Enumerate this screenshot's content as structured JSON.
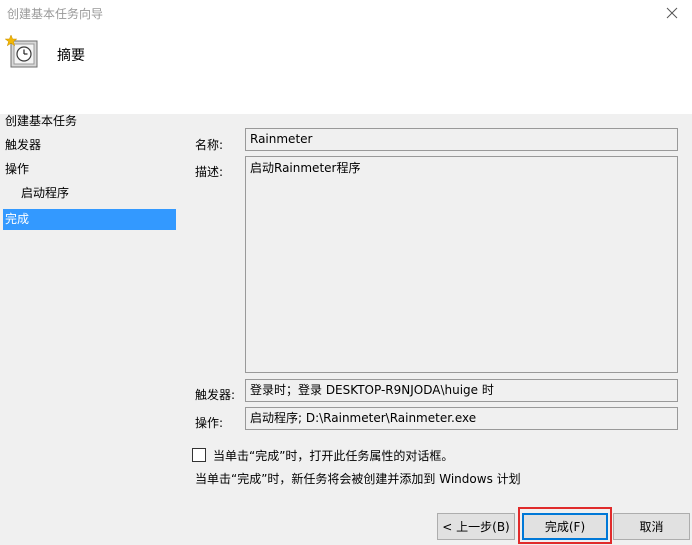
{
  "window": {
    "title": "创建基本任务向导"
  },
  "header": {
    "title": "摘要"
  },
  "nav": {
    "items": [
      {
        "label": "创建基本任务"
      },
      {
        "label": "触发器"
      },
      {
        "label": "操作"
      },
      {
        "label": "启动程序"
      },
      {
        "label": "完成"
      }
    ]
  },
  "form": {
    "name_label": "名称:",
    "name_value": "Rainmeter",
    "desc_label": "描述:",
    "desc_value": "启动Rainmeter程序",
    "trigger_label": "触发器:",
    "trigger_value": "登录时；登录 DESKTOP-R9NJODA\\huige 时",
    "action_label": "操作:",
    "action_value": "启动程序; D:\\Rainmeter\\Rainmeter.exe"
  },
  "options": {
    "open_properties_label": "当单击“完成”时，打开此任务属性的对话框。",
    "open_properties_checked": false,
    "note": "当单击“完成”时，新任务将会被创建并添加到 Windows 计划"
  },
  "buttons": {
    "back": "< 上一步(B)",
    "finish": "完成(F)",
    "cancel": "取消"
  },
  "colors": {
    "selection": "#3399ff",
    "highlight_annotation": "#e02b2b",
    "default_button_border": "#0078d7"
  }
}
